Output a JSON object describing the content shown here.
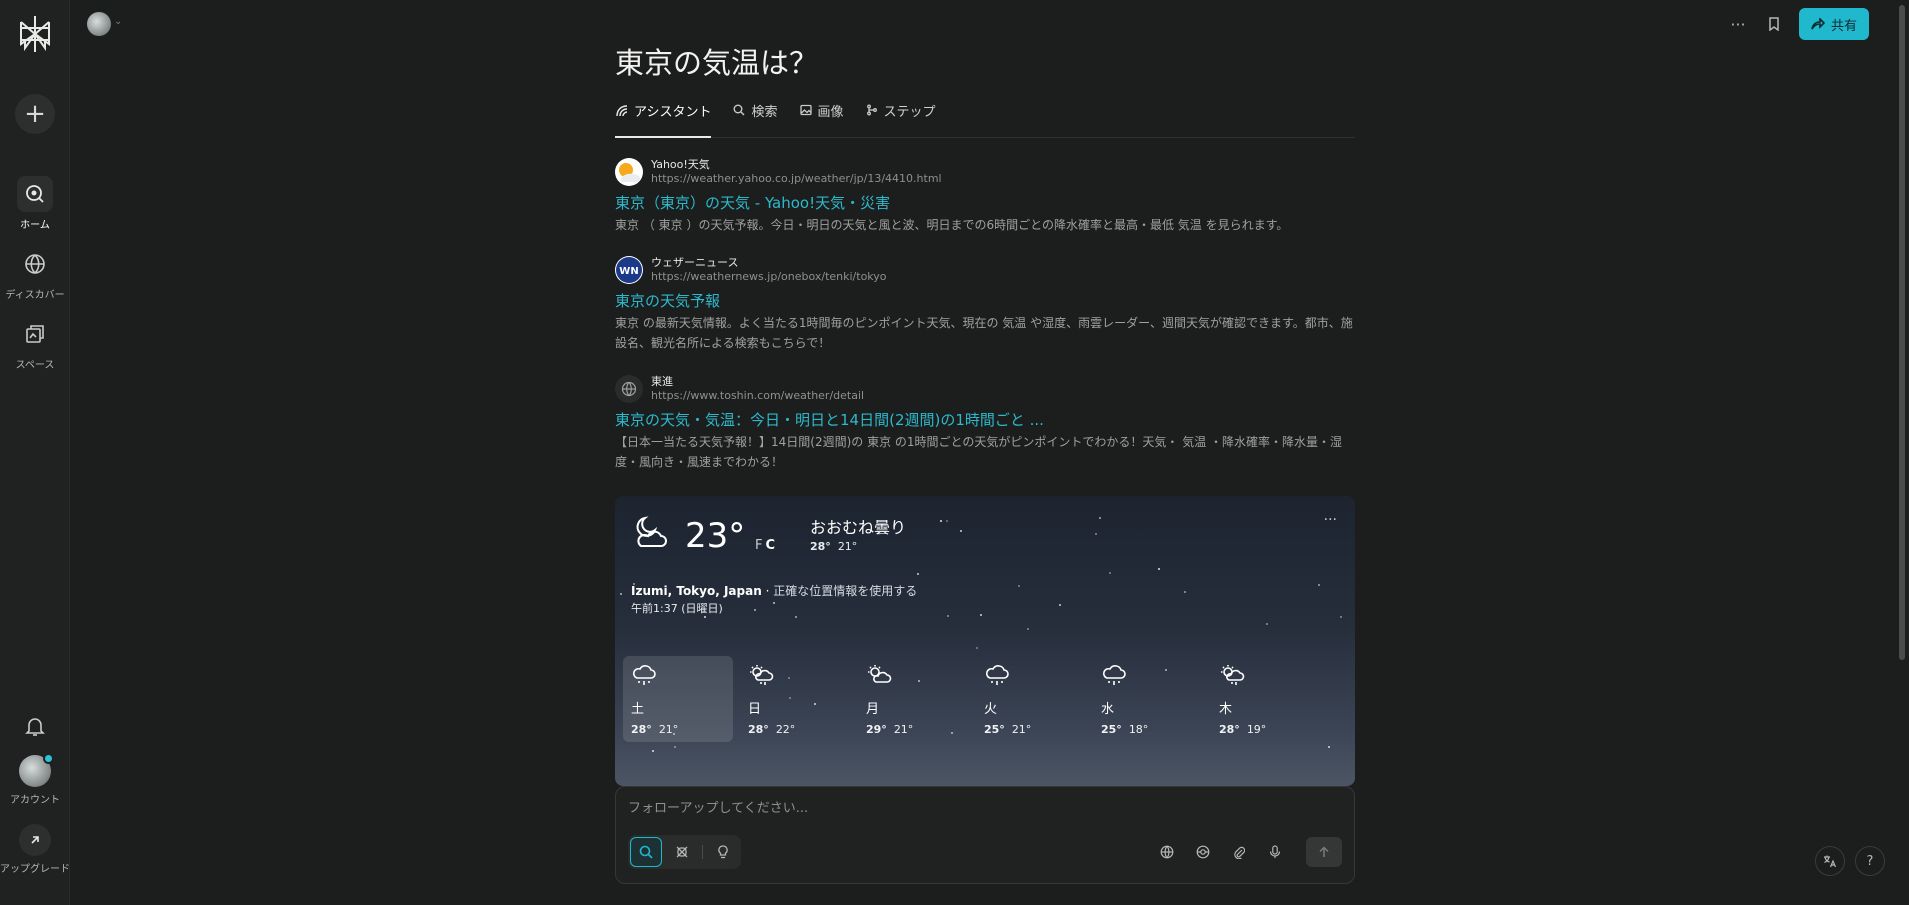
{
  "sidebar": {
    "items": [
      {
        "label": "ホーム",
        "icon": "home-search-icon"
      },
      {
        "label": "ディスカバー",
        "icon": "globe-icon"
      },
      {
        "label": "スペース",
        "icon": "spaces-icon"
      }
    ],
    "account_label": "アカウント",
    "upgrade_label": "アップグレード"
  },
  "header": {
    "share_label": "共有"
  },
  "thread": {
    "title": "東京の気温は？",
    "tabs": [
      "アシスタント",
      "検索",
      "画像",
      "ステップ"
    ],
    "results": [
      {
        "source": "Yahoo!天気",
        "url": "https://weather.yahoo.co.jp/weather/jp/13/4410.html",
        "title": "東京（東京）の天気 - Yahoo!天気・災害",
        "snippet": "東京 （ 東京 ）の天気予報。今日・明日の天気と風と波、明日までの6時間ごとの降水確率と最高・最低 気温 を見られます。"
      },
      {
        "source": "ウェザーニュース",
        "url": "https://weathernews.jp/onebox/tenki/tokyo",
        "title": "東京の天気予報",
        "snippet": "東京 の最新天気情報。よく当たる1時間毎のピンポイント天気、現在の 気温 や湿度、雨雲レーダー、週間天気が確認できます。都市、施設名、観光名所による検索もこちらで！"
      },
      {
        "source": "東進",
        "url": "https://www.toshin.com/weather/detail",
        "title": "東京の天気・気温：今日・明日と14日間(2週間)の1時間ごと ...",
        "snippet": "【日本一当たる天気予報！】14日間(2週間)の 東京 の1時間ごとの天気がピンポイントでわかる！天気・ 気温 ・降水確率・降水量・湿度・風向き・風速までわかる！"
      }
    ]
  },
  "weather": {
    "temp": "23°",
    "unit_f": "F",
    "unit_c": "C",
    "condition": "おおむね曇り",
    "hi": "28°",
    "lo": "21°",
    "location": "Izumi, Tokyo, Japan",
    "location_sep": "·",
    "precise_location_label": "正確な位置情報を使用する",
    "time": "午前1:37 (日曜日)",
    "more": "···",
    "forecast": [
      {
        "day": "土",
        "hi": "28°",
        "lo": "21°",
        "icon": "cloud-rain-icon"
      },
      {
        "day": "日",
        "hi": "28°",
        "lo": "22°",
        "icon": "sun-rain-icon"
      },
      {
        "day": "月",
        "hi": "29°",
        "lo": "21°",
        "icon": "sun-cloud-icon"
      },
      {
        "day": "火",
        "hi": "25°",
        "lo": "21°",
        "icon": "cloud-rain-icon"
      },
      {
        "day": "水",
        "hi": "25°",
        "lo": "18°",
        "icon": "cloud-rain-icon"
      },
      {
        "day": "木",
        "hi": "28°",
        "lo": "19°",
        "icon": "sun-rain-icon"
      }
    ]
  },
  "followup": {
    "placeholder": "フォローアップしてください..."
  },
  "colors": {
    "accent": "#1fb8cd",
    "link": "#2cb9cc",
    "background": "#1c1d1d",
    "sidebar": "#202222"
  }
}
